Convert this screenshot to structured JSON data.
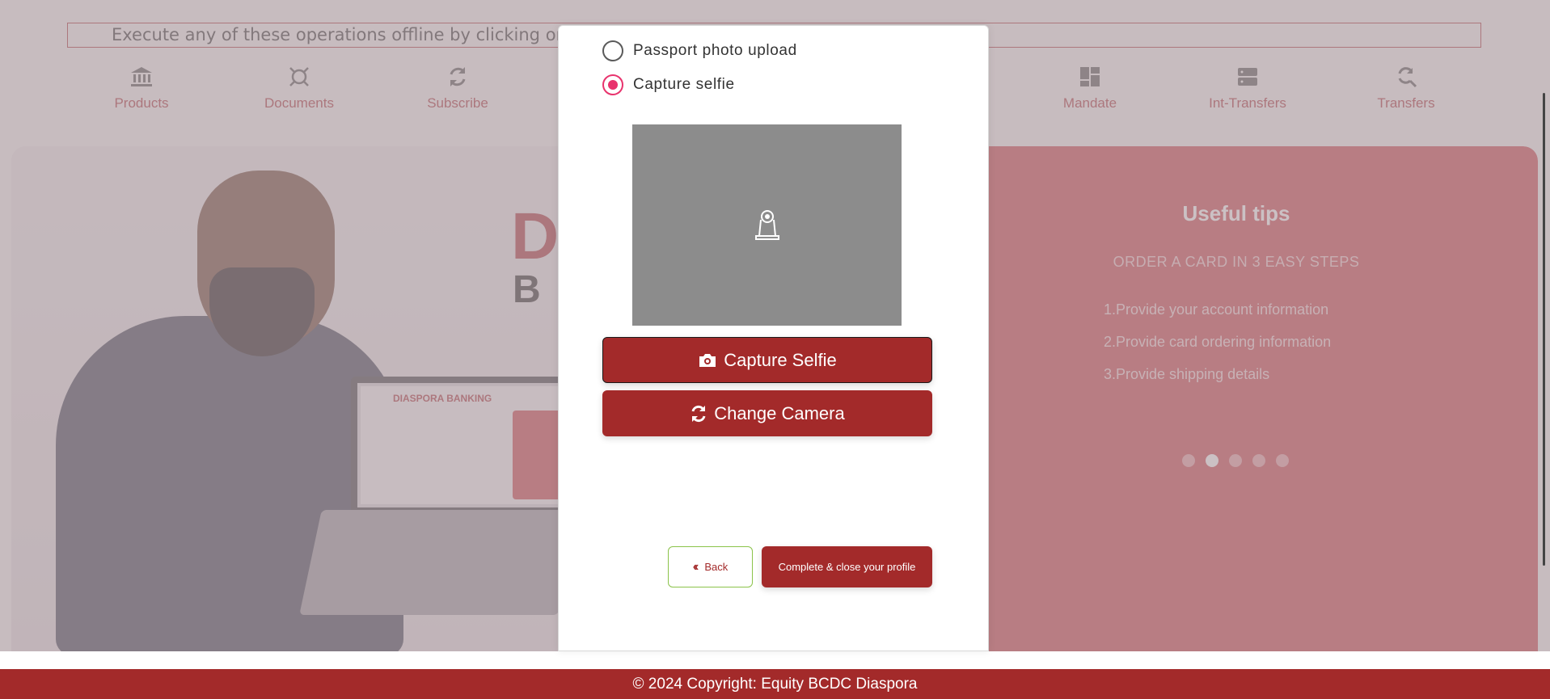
{
  "marquee": {
    "text": "Execute any of these operations offline by clicking on ... ..."
  },
  "operations": [
    {
      "label": "Products",
      "icon": "bank-icon"
    },
    {
      "label": "Documents",
      "icon": "camera-frame-icon"
    },
    {
      "label": "Subscribe",
      "icon": "refresh-icon"
    },
    {
      "label": "Mandate",
      "icon": "dashboard-icon"
    },
    {
      "label": "Int-Transfers",
      "icon": "server-icon"
    },
    {
      "label": "Transfers",
      "icon": "search-refresh-icon"
    }
  ],
  "hero": {
    "brand_letter_1": "D",
    "brand_letter_2": "B",
    "laptop_title": "DIASPORA BANKING"
  },
  "tips": {
    "title": "Useful tips",
    "subtitle": "ORDER A CARD IN 3 EASY STEPS",
    "steps": [
      "1.Provide your account information",
      "2.Provide card ordering information",
      "3.Provide shipping details"
    ],
    "slides_total": 5,
    "active_slide": 2
  },
  "modal": {
    "option_passport": "Passport photo upload",
    "option_selfie": "Capture selfie",
    "selected_option": "Capture selfie",
    "capture_button": "Capture Selfie",
    "change_camera_button": "Change Camera",
    "back_button": "Back",
    "complete_button": "Complete & close your profile"
  },
  "footer": {
    "text": "© 2024 Copyright: Equity BCDC Diaspora"
  },
  "colors": {
    "brand_red": "#a32a2a",
    "radio_pink": "#e8336d",
    "tips_bg": "#c9424a"
  }
}
